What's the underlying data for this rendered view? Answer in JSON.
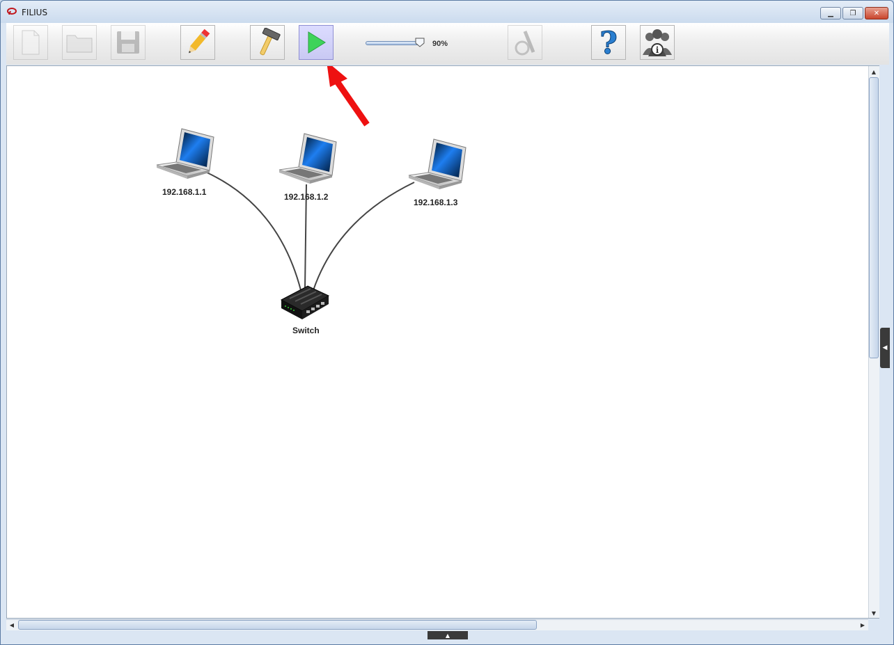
{
  "window": {
    "title": "FILIUS"
  },
  "toolbar": {
    "zoom_label": "90%",
    "zoom_level_percent": 90,
    "buttons": [
      {
        "name": "new",
        "state": "disabled"
      },
      {
        "name": "open",
        "state": "disabled"
      },
      {
        "name": "save",
        "state": "disabled"
      },
      {
        "name": "design-mode",
        "state": "normal"
      },
      {
        "name": "build-mode",
        "state": "normal"
      },
      {
        "name": "simulation-mode",
        "state": "active"
      },
      {
        "name": "wizard",
        "state": "disabled"
      },
      {
        "name": "help",
        "state": "normal"
      },
      {
        "name": "info",
        "state": "normal"
      }
    ]
  },
  "network": {
    "nodes": [
      {
        "id": "pc1",
        "type": "laptop",
        "label": "192.168.1.1"
      },
      {
        "id": "pc2",
        "type": "laptop",
        "label": "192.168.1.2"
      },
      {
        "id": "pc3",
        "type": "laptop",
        "label": "192.168.1.3"
      },
      {
        "id": "sw1",
        "type": "switch",
        "label": "Switch"
      }
    ],
    "links": [
      [
        "pc1",
        "sw1"
      ],
      [
        "pc2",
        "sw1"
      ],
      [
        "pc3",
        "sw1"
      ]
    ]
  },
  "annotation": {
    "arrow_color": "#ee1111"
  }
}
